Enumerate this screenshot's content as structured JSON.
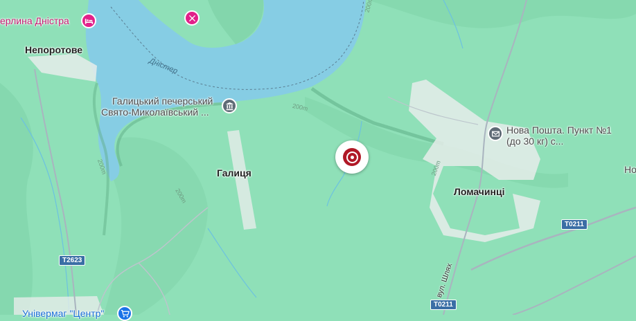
{
  "colors": {
    "land": "#8fe0b8",
    "water": "#86cde4",
    "road": "#a9b4bf",
    "settlement": "#e6ecea",
    "poi_pink": "#e2208a",
    "poi_gray": "#5f6b76",
    "marker": "#b01826"
  },
  "labels": {
    "hotel": "ерлина Дністра",
    "village_neporotove": "Непоротове",
    "river": "Дністер",
    "monastery_line1": "Галицький печерський",
    "monastery_line2": "Свято-Миколаївський ...",
    "village_halytsia": "Галиця",
    "post_line1": "Нова Пошта. Пункт №1",
    "post_line2": "(до 30 кг) с...",
    "village_lomachyntsi": "Ломачинці",
    "edge_right": "Но",
    "store": "Універмаг \"Центр\"",
    "street": "вул. Шлях"
  },
  "contours": [
    "200m",
    "200m",
    "200m",
    "200m",
    "200m"
  ],
  "roads": {
    "t2623": "T2623",
    "t0211_a": "T0211",
    "t0211_b": "T0211"
  },
  "icons": {
    "hotel": "bed-icon",
    "attraction": "hiking-icon",
    "monastery": "monument-icon",
    "post": "mail-icon",
    "store": "shopping-cart-icon",
    "marker": "target-marker-icon"
  }
}
